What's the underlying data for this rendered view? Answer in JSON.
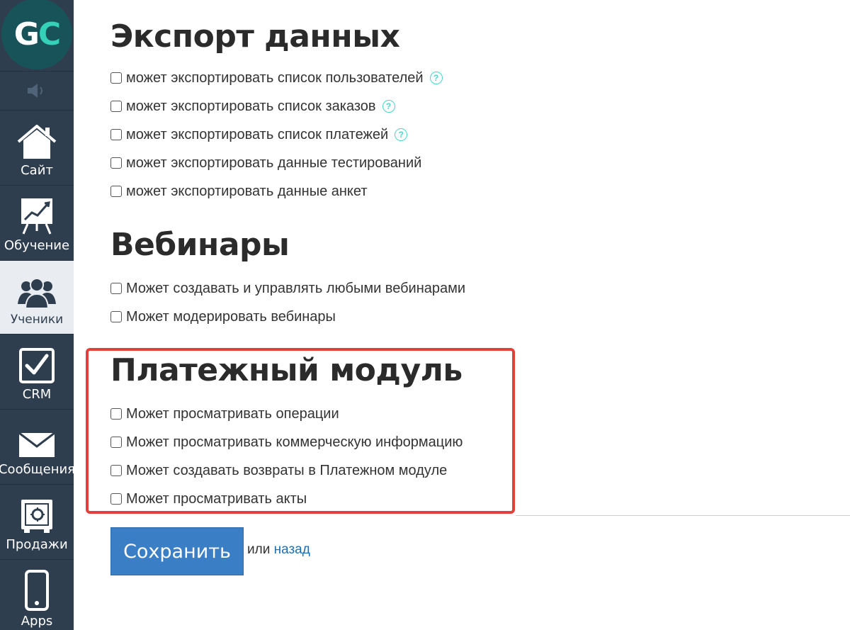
{
  "sidebar": {
    "logo": {
      "text_g": "G",
      "text_c": "C"
    },
    "sound_icon": "speaker-icon",
    "items": [
      {
        "label": "Сайт",
        "icon": "home-icon",
        "active": false
      },
      {
        "label": "Обучение",
        "icon": "chart-board-icon",
        "active": false
      },
      {
        "label": "Ученики",
        "icon": "users-icon",
        "active": true
      },
      {
        "label": "CRM",
        "icon": "checkbox-icon",
        "active": false
      },
      {
        "label": "Сообщения",
        "icon": "envelope-icon",
        "active": false
      },
      {
        "label": "Продажи",
        "icon": "safe-icon",
        "active": false
      },
      {
        "label": "Apps",
        "icon": "phone-icon",
        "active": false
      }
    ]
  },
  "sections": [
    {
      "title": "Экспорт данных",
      "options": [
        {
          "label": "может экспортировать список пользователей",
          "help": true,
          "checked": false
        },
        {
          "label": "может экспортировать список заказов",
          "help": true,
          "checked": false
        },
        {
          "label": "может экспортировать список платежей",
          "help": true,
          "checked": false
        },
        {
          "label": "может экспортировать данные тестирований",
          "help": false,
          "checked": false
        },
        {
          "label": "может экспортировать данные анкет",
          "help": false,
          "checked": false
        }
      ]
    },
    {
      "title": "Вебинары",
      "options": [
        {
          "label": "Может создавать и управлять любыми вебинарами",
          "help": false,
          "checked": false
        },
        {
          "label": "Может модерировать вебинары",
          "help": false,
          "checked": false
        }
      ]
    },
    {
      "title": "Платежный модуль",
      "options": [
        {
          "label": "Может просматривать операции",
          "help": false,
          "checked": false
        },
        {
          "label": "Может просматривать коммерческую информацию",
          "help": false,
          "checked": false
        },
        {
          "label": "Может создавать возвраты в Платежном модуле",
          "help": false,
          "checked": false
        },
        {
          "label": "Может просматривать акты",
          "help": false,
          "checked": false
        }
      ]
    }
  ],
  "help_glyph": "?",
  "footer": {
    "save_label": "Сохранить",
    "or_text": "или",
    "back_label": "назад"
  },
  "colors": {
    "sidebar_bg": "#2f3e4f",
    "accent_teal": "#34d0b8",
    "highlight_border": "#e0413a",
    "button_blue": "#3a7ec5",
    "link_blue": "#1a6fb5"
  }
}
